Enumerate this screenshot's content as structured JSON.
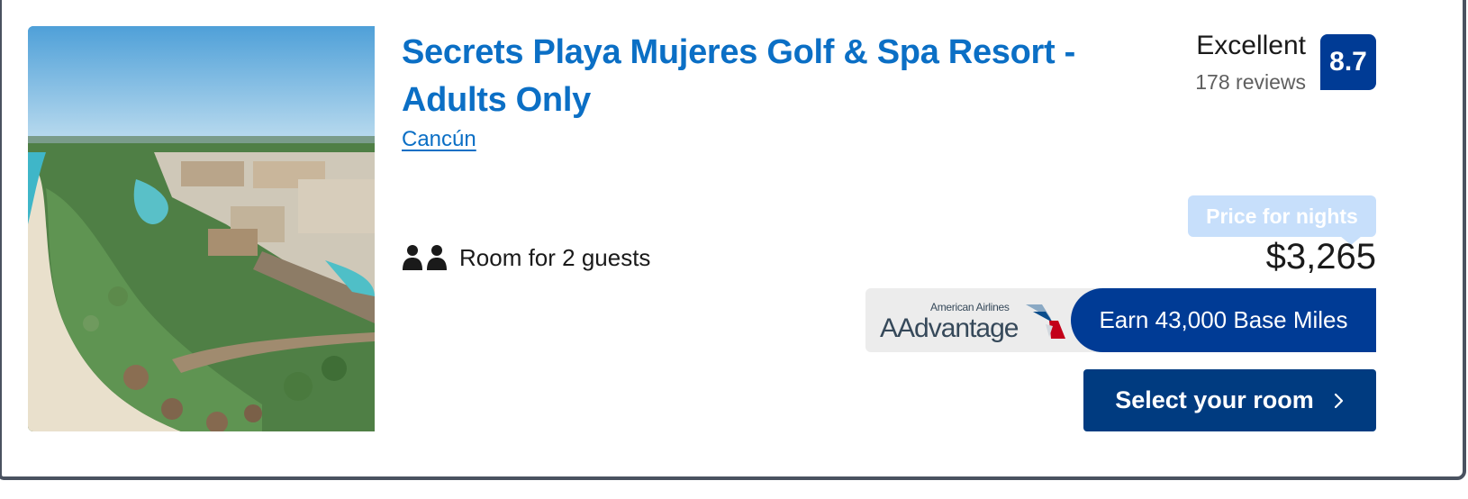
{
  "hotel": {
    "name": "Secrets Playa Mujeres Golf & Spa Resort - Adults Only",
    "location": "Cancún",
    "occupancy": "Room for 2 guests",
    "image_alt": "Aerial view of beachfront resort"
  },
  "rating": {
    "label": "Excellent",
    "reviews": "178 reviews",
    "score": "8.7"
  },
  "pricing": {
    "label": "Price for nights",
    "amount": "$3,265"
  },
  "loyalty": {
    "brand_small": "American Airlines",
    "brand_big": "AAdvantage",
    "miles_text": "Earn 43,000 Base Miles"
  },
  "actions": {
    "select_label": "Select your room"
  },
  "icons": {
    "guests": "two-people-icon",
    "chevron": "chevron-right-icon",
    "aa_logo": "american-airlines-eagle-icon"
  },
  "colors": {
    "link_blue": "#0b6fc5",
    "brand_navy": "#003b95",
    "button_navy": "#003b80",
    "price_label_bg": "#c7dffb",
    "aa_box_bg": "#ececec"
  }
}
